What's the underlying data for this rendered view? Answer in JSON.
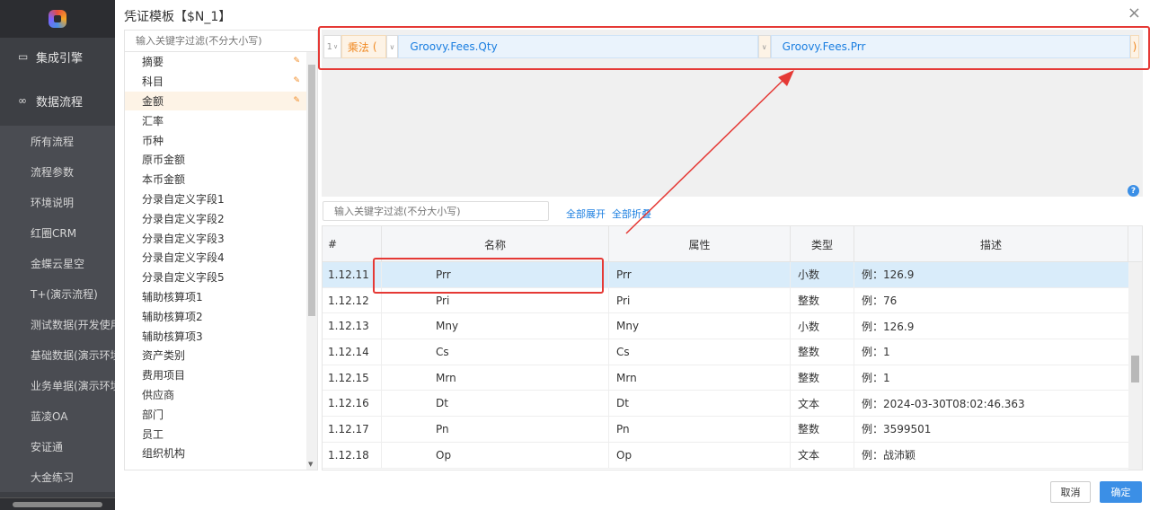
{
  "app_sidebar": {
    "groups": [
      {
        "icon": "monitor-icon",
        "label": "集成引擎"
      },
      {
        "icon": "infinity-icon",
        "label": "数据流程"
      }
    ],
    "items": [
      "所有流程",
      "流程参数",
      "环境说明",
      "红圈CRM",
      "金蝶云星空",
      "T+(演示流程)",
      "测试数据(开发使用",
      "基础数据(演示环境",
      "业务单据(演示环境",
      "蓝凌OA",
      "安证通",
      "大金练习"
    ]
  },
  "dialog": {
    "title": "凭证模板【$N_1】",
    "close": "×"
  },
  "field_panel": {
    "search_placeholder": "输入关键字过滤(不分大小写)",
    "items": [
      {
        "label": "摘要",
        "icon": "edit-icon"
      },
      {
        "label": "科目",
        "icon": "edit-icon"
      },
      {
        "label": "金额",
        "icon": "edit-icon",
        "active": true
      },
      {
        "label": "汇率"
      },
      {
        "label": "币种"
      },
      {
        "label": "原币金额"
      },
      {
        "label": "本币金额"
      },
      {
        "label": "分录自定义字段1"
      },
      {
        "label": "分录自定义字段2"
      },
      {
        "label": "分录自定义字段3"
      },
      {
        "label": "分录自定义字段4"
      },
      {
        "label": "分录自定义字段5"
      },
      {
        "label": "辅助核算项1"
      },
      {
        "label": "辅助核算项2"
      },
      {
        "label": "辅助核算项3"
      },
      {
        "label": "资产类别"
      },
      {
        "label": "费用项目"
      },
      {
        "label": "供应商"
      },
      {
        "label": "部门"
      },
      {
        "label": "员工"
      },
      {
        "label": "组织机构"
      },
      {
        "label": "..."
      }
    ]
  },
  "expression": {
    "line_number": "1",
    "operator": "乘法",
    "open_paren": "(",
    "close_paren": ")",
    "operand1": "Groovy.Fees.Qty",
    "operand2": "Groovy.Fees.Prr",
    "help": "?"
  },
  "tree_toolbar": {
    "search_placeholder": "输入关键字过滤(不分大小写)",
    "expand_all": "全部展开",
    "collapse_all": "全部折叠"
  },
  "table": {
    "headers": [
      "#",
      "名称",
      "属性",
      "类型",
      "描述"
    ],
    "rows": [
      {
        "id": "1.12.11",
        "name": "Prr",
        "attr": "Prr",
        "type": "小数",
        "desc": "例：126.9",
        "selected": true
      },
      {
        "id": "1.12.12",
        "name": "Pri",
        "attr": "Pri",
        "type": "整数",
        "desc": "例：76"
      },
      {
        "id": "1.12.13",
        "name": "Mny",
        "attr": "Mny",
        "type": "小数",
        "desc": "例：126.9"
      },
      {
        "id": "1.12.14",
        "name": "Cs",
        "attr": "Cs",
        "type": "整数",
        "desc": "例：1"
      },
      {
        "id": "1.12.15",
        "name": "Mrn",
        "attr": "Mrn",
        "type": "整数",
        "desc": "例：1"
      },
      {
        "id": "1.12.16",
        "name": "Dt",
        "attr": "Dt",
        "type": "文本",
        "desc": "例：2024-03-30T08:02:46.363"
      },
      {
        "id": "1.12.17",
        "name": "Pn",
        "attr": "Pn",
        "type": "整数",
        "desc": "例：3599501"
      },
      {
        "id": "1.12.18",
        "name": "Op",
        "attr": "Op",
        "type": "文本",
        "desc": "例：战沛颖"
      }
    ]
  },
  "footer": {
    "cancel": "取消",
    "ok": "确定"
  },
  "colors": {
    "annotation": "#e53935",
    "accent_blue": "#3b8fe6",
    "operator_orange": "#f08a24"
  }
}
